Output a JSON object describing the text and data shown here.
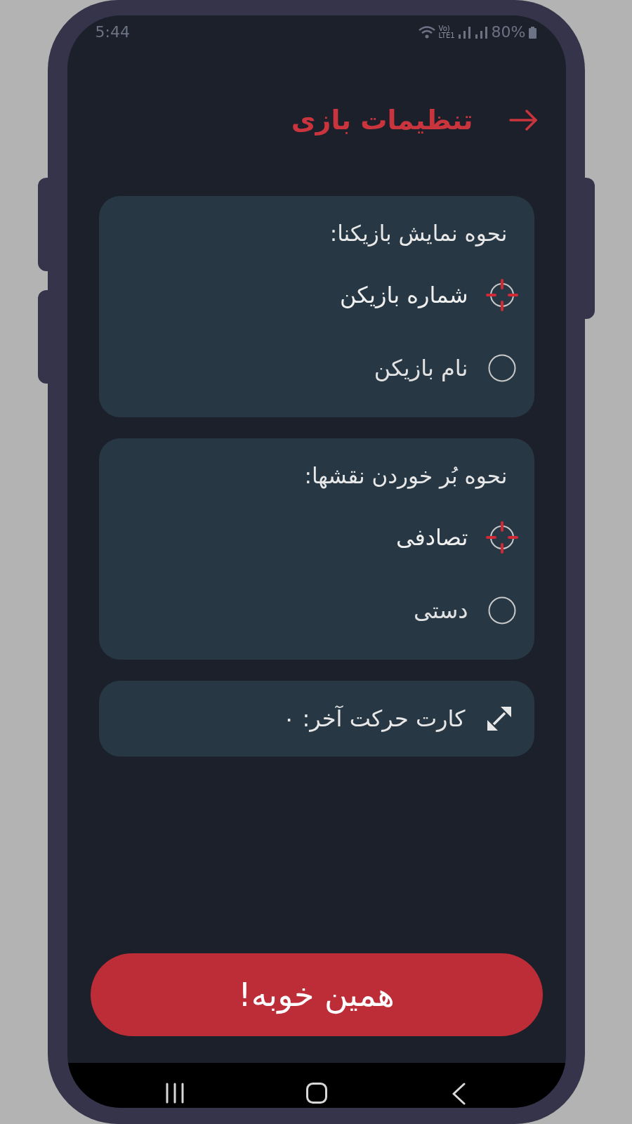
{
  "status_bar": {
    "time": "5:44",
    "network_label": [
      "Vo)",
      "LTE1"
    ],
    "battery": "80%"
  },
  "header": {
    "title": "تنظیمات بازی"
  },
  "groups": [
    {
      "title": "نحوه نمایش بازیکنا:",
      "options": [
        {
          "label": "شماره بازیکن",
          "selected": true
        },
        {
          "label": "نام بازیکن",
          "selected": false
        }
      ]
    },
    {
      "title": "نحوه بُر خوردن نقشها:",
      "options": [
        {
          "label": "تصادفی",
          "selected": true
        },
        {
          "label": "دستی",
          "selected": false
        }
      ]
    }
  ],
  "last_move": {
    "label": "کارت حرکت آخر: ۰"
  },
  "confirm_button": {
    "label": "همین خوبه!"
  }
}
